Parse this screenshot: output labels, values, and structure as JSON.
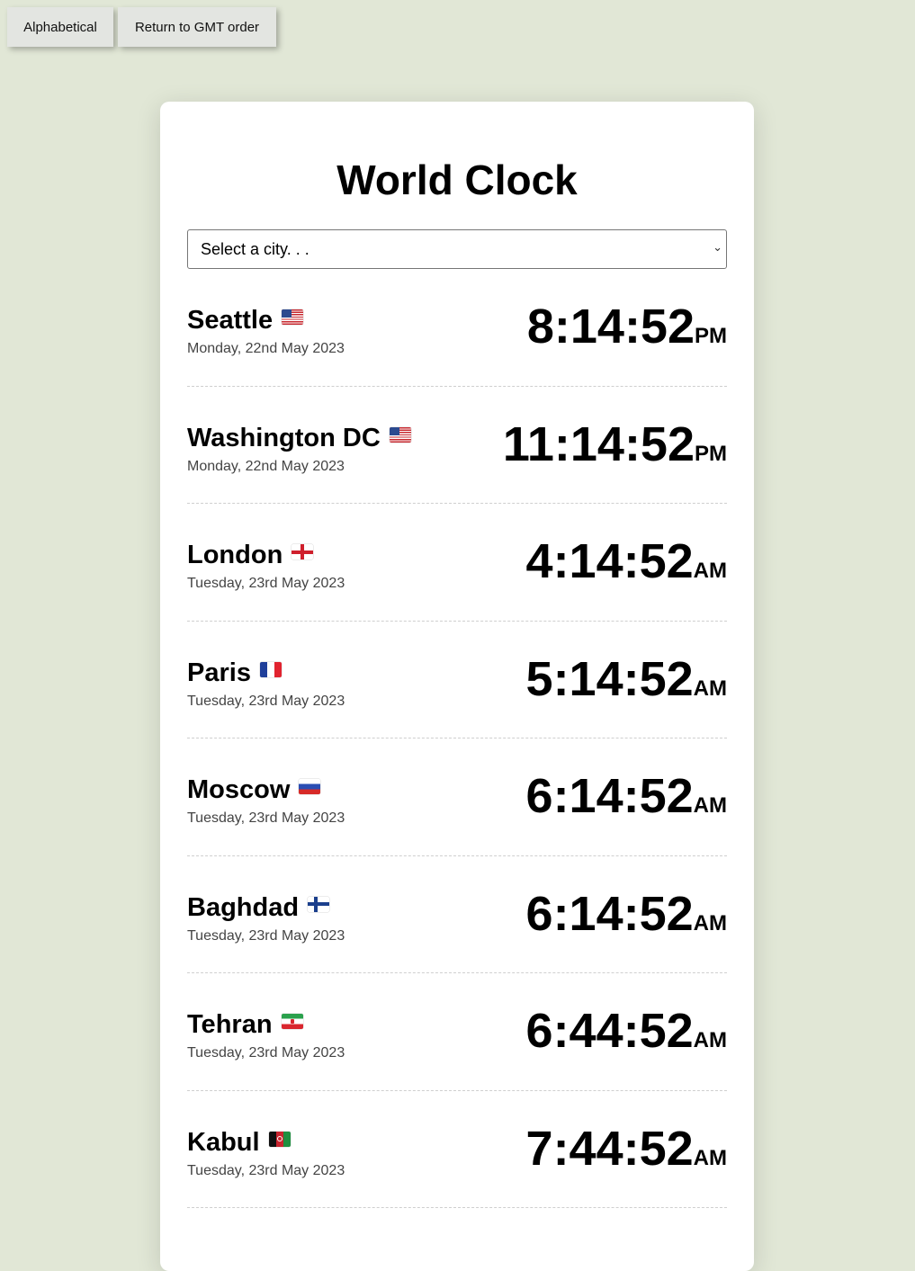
{
  "buttons": {
    "alphabetical": "Alphabetical",
    "gmt_order": "Return to GMT order"
  },
  "title": "World Clock",
  "city_select": {
    "selected": "Select a city. . ."
  },
  "colors": {
    "page_background": "#e1e7d6",
    "card_background": "#ffffff"
  },
  "clocks": [
    {
      "city": "Seattle",
      "flag": "us-flag-icon",
      "date": "Monday, 22nd May 2023",
      "time": "8:14:52",
      "ampm": "PM"
    },
    {
      "city": "Washington DC",
      "flag": "us-flag-icon",
      "date": "Monday, 22nd May 2023",
      "time": "11:14:52",
      "ampm": "PM"
    },
    {
      "city": "London",
      "flag": "england-flag-icon",
      "date": "Tuesday, 23rd May 2023",
      "time": "4:14:52",
      "ampm": "AM"
    },
    {
      "city": "Paris",
      "flag": "france-flag-icon",
      "date": "Tuesday, 23rd May 2023",
      "time": "5:14:52",
      "ampm": "AM"
    },
    {
      "city": "Moscow",
      "flag": "russia-flag-icon",
      "date": "Tuesday, 23rd May 2023",
      "time": "6:14:52",
      "ampm": "AM"
    },
    {
      "city": "Baghdad",
      "flag": "finland-flag-icon",
      "date": "Tuesday, 23rd May 2023",
      "time": "6:14:52",
      "ampm": "AM"
    },
    {
      "city": "Tehran",
      "flag": "iran-flag-icon",
      "date": "Tuesday, 23rd May 2023",
      "time": "6:44:52",
      "ampm": "AM"
    },
    {
      "city": "Kabul",
      "flag": "afghanistan-flag-icon",
      "date": "Tuesday, 23rd May 2023",
      "time": "7:44:52",
      "ampm": "AM"
    }
  ]
}
